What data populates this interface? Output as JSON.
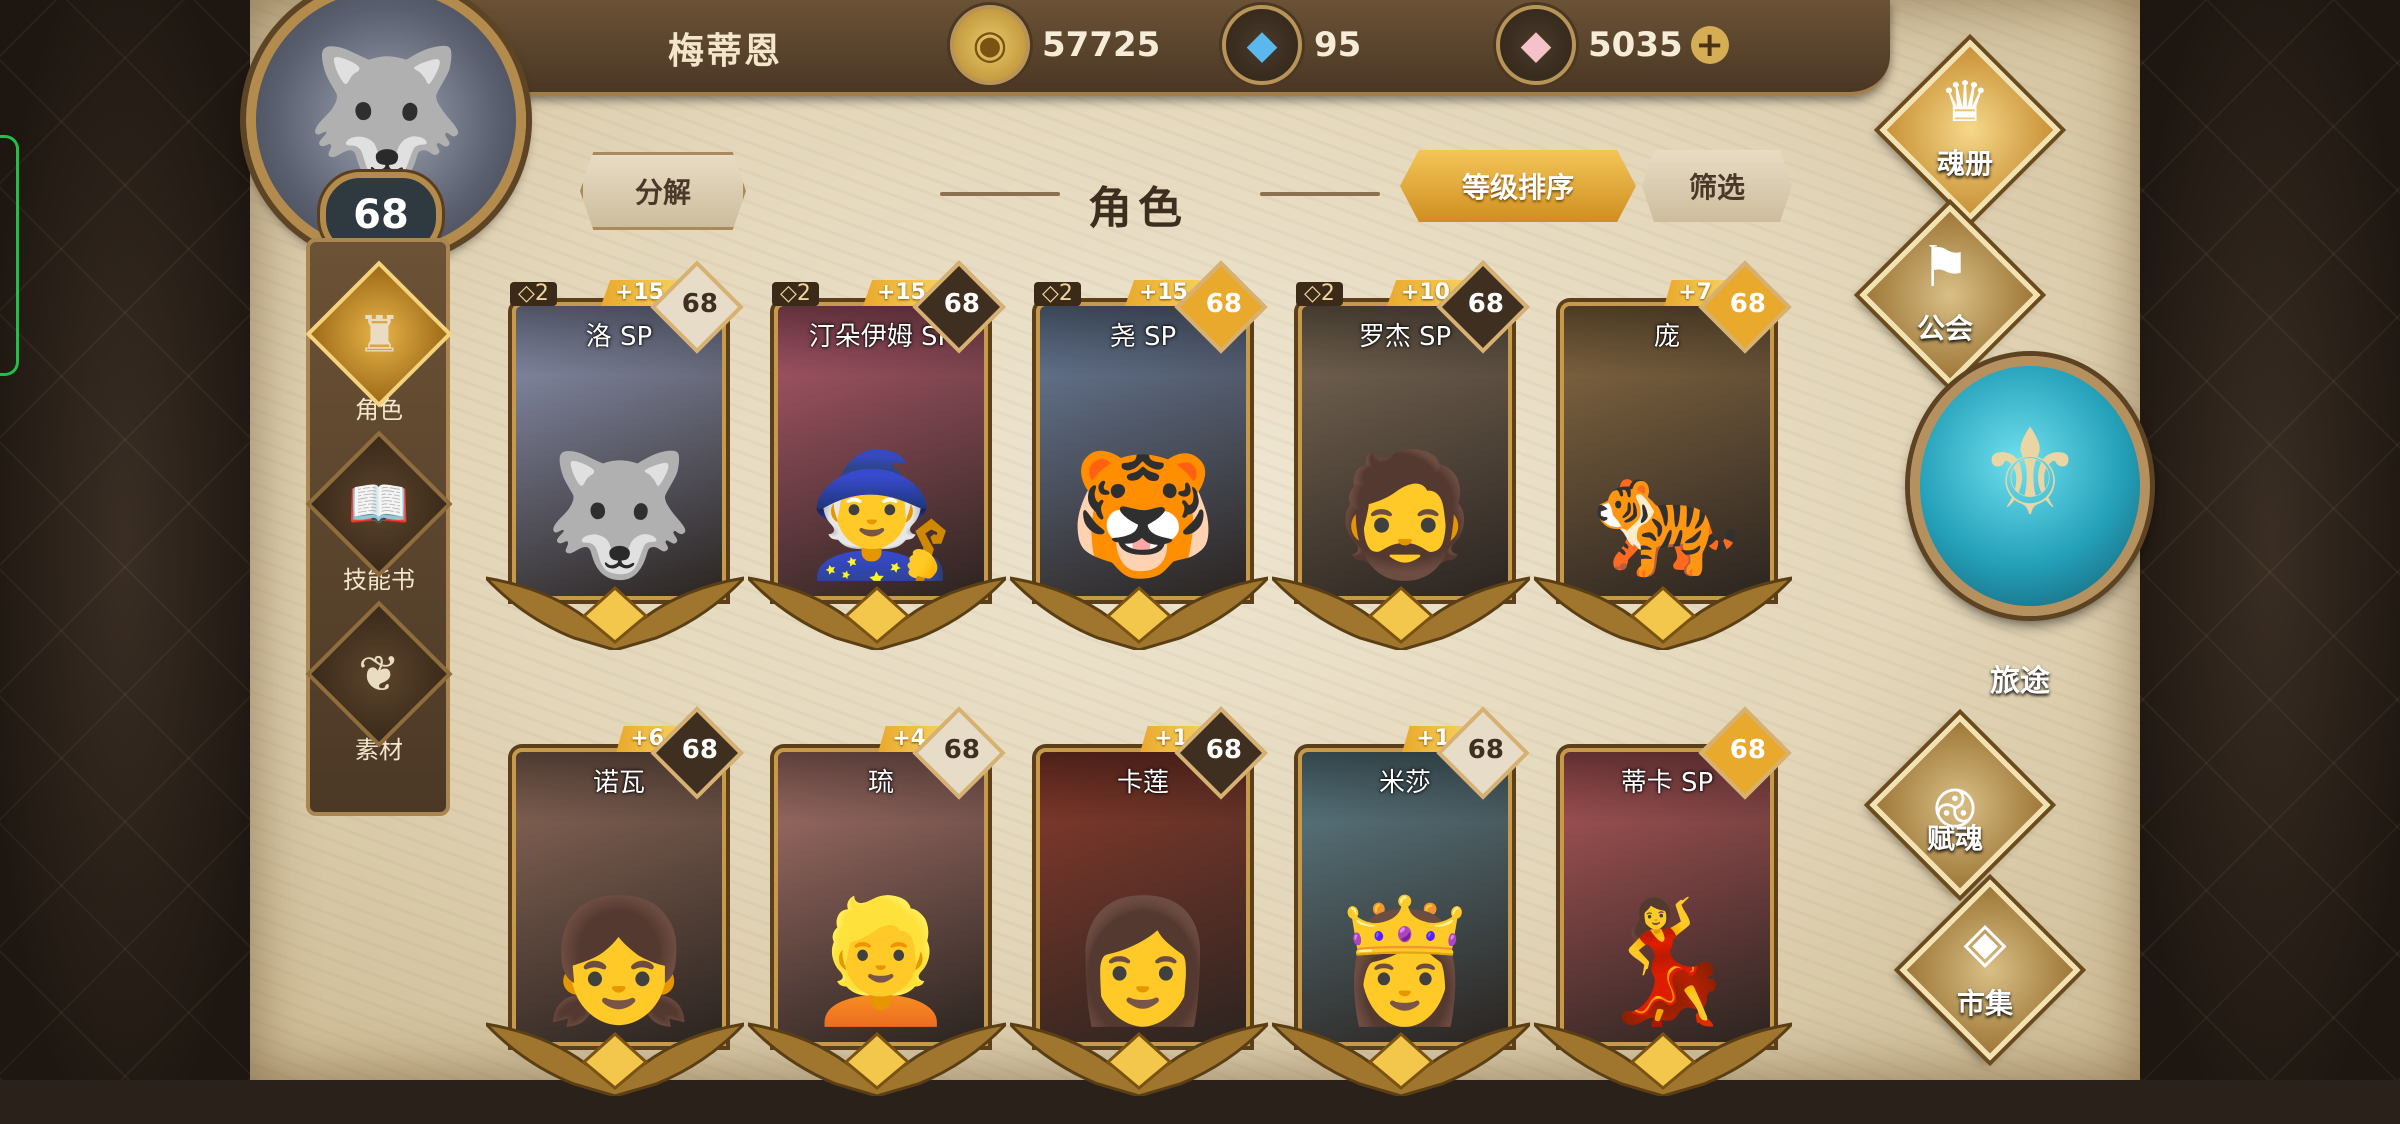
{
  "player": {
    "name": "梅蒂恩",
    "level": "68",
    "avatar_icon": "wolf-avatar-icon"
  },
  "resources": {
    "gold": {
      "value": "57725",
      "icon": "gold-coin-icon"
    },
    "gem": {
      "value": "95",
      "icon": "blue-crystal-icon"
    },
    "crystal": {
      "value": "5035",
      "icon": "pink-crystal-icon",
      "add_label": "+"
    }
  },
  "left_nav": [
    {
      "label": "角色",
      "icon": "character-icon",
      "active": true
    },
    {
      "label": "技能书",
      "icon": "skill-book-icon",
      "active": false
    },
    {
      "label": "素材",
      "icon": "material-icon",
      "active": false
    }
  ],
  "header": {
    "decompose_label": "分解",
    "title": "角色",
    "sort_label": "等级排序",
    "filter_label": "筛选"
  },
  "cards": [
    {
      "name": "洛 SP",
      "stars": "◇2",
      "plus": "+15",
      "level": "68",
      "lvl_style": "light",
      "bg": "#8f97b6",
      "face": "🐺"
    },
    {
      "name": "汀朵伊姆 SP",
      "stars": "◇2",
      "plus": "+15",
      "level": "68",
      "lvl_style": "dark",
      "bg": "#b35a6d",
      "face": "🧙"
    },
    {
      "name": "尧 SP",
      "stars": "◇2",
      "plus": "+15",
      "level": "68",
      "lvl_style": "gold",
      "bg": "#6b7f9e",
      "face": "🐯"
    },
    {
      "name": "罗杰 SP",
      "stars": "◇2",
      "plus": "+10",
      "level": "68",
      "lvl_style": "dark",
      "bg": "#7b6a56",
      "face": "🧔"
    },
    {
      "name": "庞",
      "stars": "",
      "plus": "+7",
      "level": "68",
      "lvl_style": "gold",
      "bg": "#8a6c43",
      "face": "🐅"
    },
    {
      "name": "诺瓦",
      "stars": "",
      "plus": "+6",
      "level": "68",
      "lvl_style": "dark",
      "bg": "#8e6a5a",
      "face": "👧"
    },
    {
      "name": "琉",
      "stars": "",
      "plus": "+4",
      "level": "68",
      "lvl_style": "light",
      "bg": "#a9746c",
      "face": "👱"
    },
    {
      "name": "卡莲",
      "stars": "",
      "plus": "+1",
      "level": "68",
      "lvl_style": "dark",
      "bg": "#8c3b2c",
      "face": "👩"
    },
    {
      "name": "米莎",
      "stars": "",
      "plus": "+1",
      "level": "68",
      "lvl_style": "light",
      "bg": "#5d7f89",
      "face": "👸"
    },
    {
      "name": "蒂卡 SP",
      "stars": "",
      "plus": "",
      "level": "68",
      "lvl_style": "gold",
      "bg": "#b1575a",
      "face": "💃"
    }
  ],
  "right_nav": {
    "soul_book": {
      "label": "魂册",
      "icon": "helmet-icon"
    },
    "guild": {
      "label": "公会",
      "icon": "guild-banner-icon"
    },
    "journey": {
      "label": "旅途",
      "icon": "journey-orb-icon"
    },
    "endow": {
      "label": "赋魂",
      "icon": "spiral-icon"
    },
    "market": {
      "label": "市集",
      "icon": "gem-market-icon"
    }
  },
  "colors": {
    "accent_gold": "#e9a92c",
    "parchment": "#e3d6b9",
    "frame_brown": "#4a3724"
  }
}
